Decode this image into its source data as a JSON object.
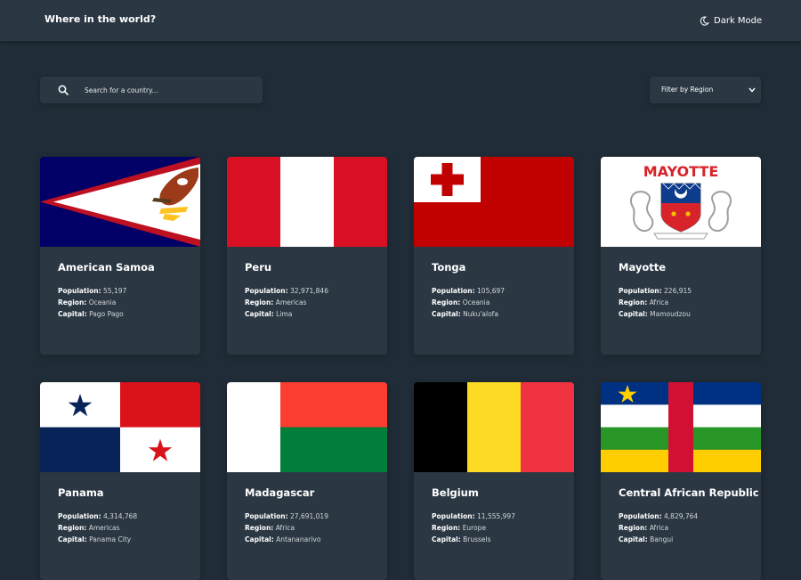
{
  "header": {
    "title": "Where in the world?",
    "dark_mode_label": "Dark Mode",
    "dark_mode_icon": "moon-icon"
  },
  "search": {
    "placeholder": "Search for a country...",
    "icon": "search-icon"
  },
  "filter": {
    "label": "Filter by Region",
    "icon": "chevron-down-icon"
  },
  "labels": {
    "population": "Population:",
    "region": "Region:",
    "capital": "Capital:"
  },
  "colors": {
    "background": "#202c37",
    "element": "#2b3844",
    "text": "#ffffff"
  },
  "countries": [
    {
      "name": "American Samoa",
      "population": "55,197",
      "region": "Oceania",
      "capital": "Pago Pago",
      "flag": "american-samoa-flag"
    },
    {
      "name": "Peru",
      "population": "32,971,846",
      "region": "Americas",
      "capital": "Lima",
      "flag": "peru-flag"
    },
    {
      "name": "Tonga",
      "population": "105,697",
      "region": "Oceania",
      "capital": "Nuku'alofa",
      "flag": "tonga-flag"
    },
    {
      "name": "Mayotte",
      "population": "226,915",
      "region": "Africa",
      "capital": "Mamoudzou",
      "flag": "mayotte-flag",
      "flag_text": "MAYOTTE"
    },
    {
      "name": "Panama",
      "population": "4,314,768",
      "region": "Americas",
      "capital": "Panama City",
      "flag": "panama-flag"
    },
    {
      "name": "Madagascar",
      "population": "27,691,019",
      "region": "Africa",
      "capital": "Antananarivo",
      "flag": "madagascar-flag"
    },
    {
      "name": "Belgium",
      "population": "11,555,997",
      "region": "Europe",
      "capital": "Brussels",
      "flag": "belgium-flag"
    },
    {
      "name": "Central African Republic",
      "population": "4,829,764",
      "region": "Africa",
      "capital": "Bangui",
      "flag": "central-african-republic-flag"
    }
  ]
}
